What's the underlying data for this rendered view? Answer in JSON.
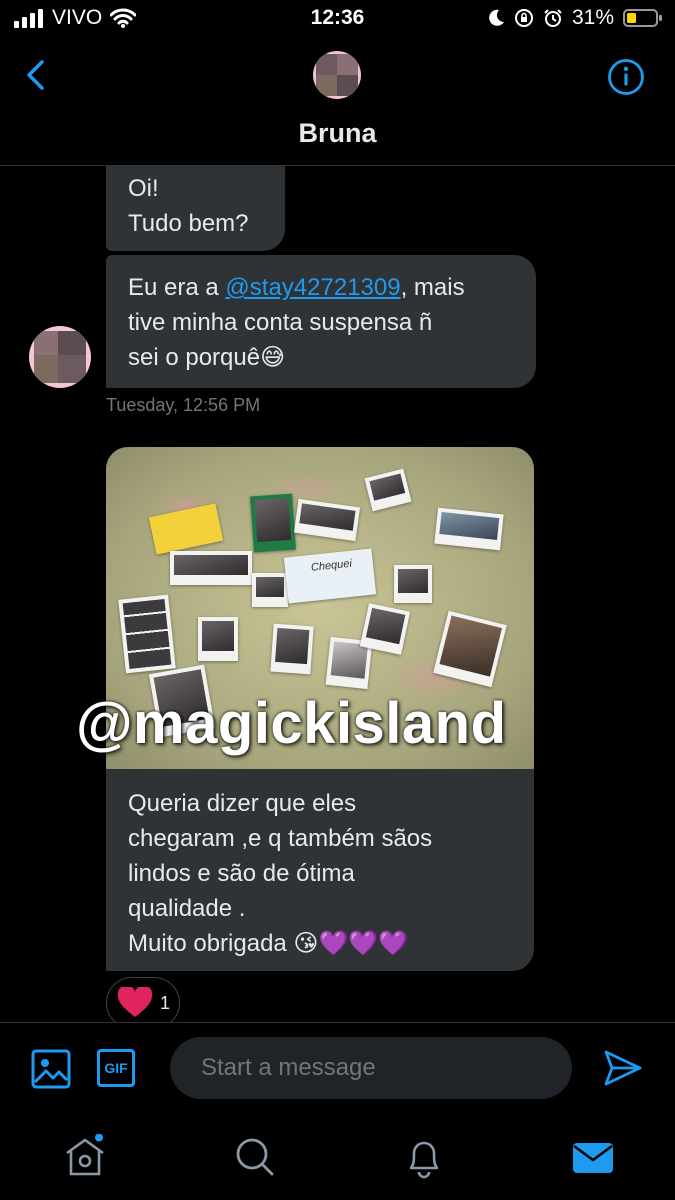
{
  "status_bar": {
    "carrier": "VIVO",
    "time": "12:36",
    "battery": "31%",
    "icons": [
      "signal-icon",
      "wifi-icon",
      "moon-icon",
      "orientation-lock-icon",
      "alarm-icon",
      "battery-icon"
    ]
  },
  "header": {
    "contact_name": "Bruna",
    "back_icon": "chevron-left-icon",
    "info_icon": "info-icon"
  },
  "messages": [
    {
      "lines": [
        "Oi!",
        "Tudo bem?"
      ]
    },
    {
      "line1_before": "Eu era a ",
      "mention": "@stay42721309",
      "line1_after": ", mais",
      "line2": "tive minha conta suspensa  ñ",
      "line3": "sei o  porquê😅"
    }
  ],
  "timestamp": "Tuesday, 12:56 PM",
  "photo_message": {
    "watermark": "@magickisland",
    "card_text": "Chequei"
  },
  "caption_lines": [
    "Queria dizer que eles",
    "chegaram ,e q também  sãos",
    "lindos e  são de ótima",
    "qualidade  .",
    "Muito obrigada 😘💜💜💜"
  ],
  "reaction": {
    "emoji": "heart",
    "count": "1"
  },
  "composer": {
    "placeholder": "Start a message",
    "gif_label": "GIF",
    "icons": [
      "image-icon",
      "gif-icon",
      "send-icon"
    ]
  },
  "colors": {
    "accent": "#1d9bf0",
    "bubble": "#2f3336",
    "background": "#000000"
  },
  "tab_bar": {
    "icons": [
      "home-icon",
      "search-icon",
      "notifications-icon",
      "messages-icon"
    ],
    "active": "messages-icon"
  }
}
